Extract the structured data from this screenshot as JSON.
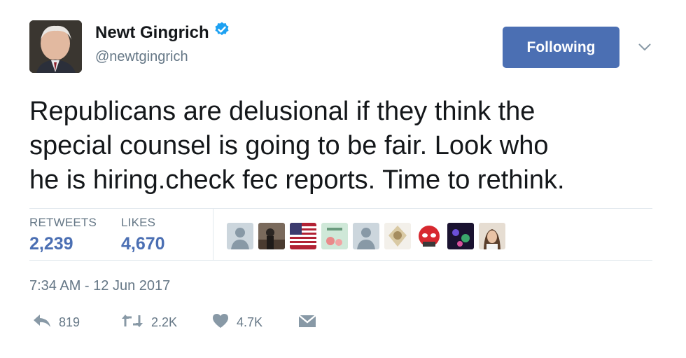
{
  "user": {
    "name": "Newt Gingrich",
    "handle": "@newtgingrich",
    "verified": true
  },
  "follow_button_label": "Following",
  "tweet_lines": [
    "Republicans are delusional if they think the",
    "special counsel is going to be fair. Look who",
    "he is hiring.check fec reports. Time to rethink."
  ],
  "stats": {
    "retweets_label": "RETWEETS",
    "retweets_value": "2,239",
    "likes_label": "LIKES",
    "likes_value": "4,670"
  },
  "timestamp": "7:34 AM - 12 Jun 2017",
  "actions": {
    "reply_count": "819",
    "retweet_count": "2.2K",
    "like_count": "4.7K"
  },
  "colors": {
    "accent": "#4b6fb3",
    "verified": "#1da1f2",
    "muted": "#657786",
    "divider": "#e1e8ed"
  },
  "icons": [
    "verified-badge-icon",
    "chevron-down-icon",
    "reply-icon",
    "retweet-icon",
    "heart-icon",
    "message-icon"
  ]
}
